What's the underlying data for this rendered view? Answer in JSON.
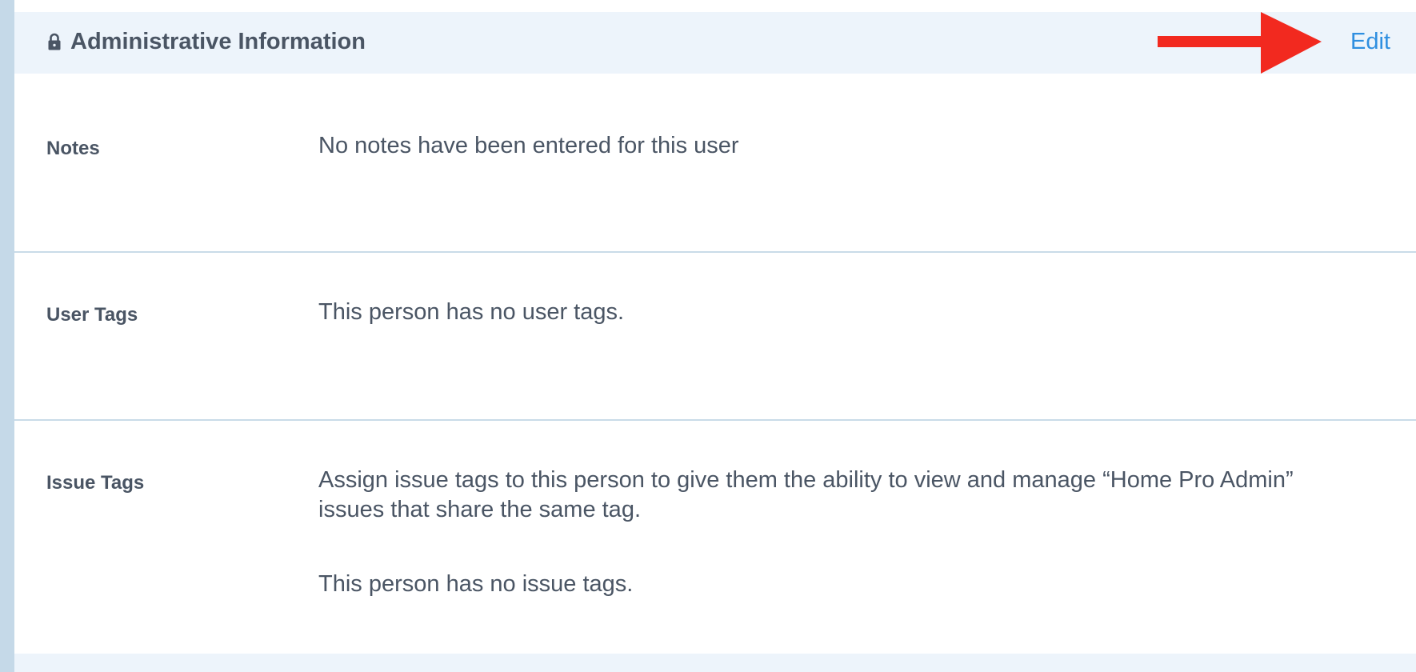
{
  "header": {
    "title": "Administrative Information",
    "edit_label": "Edit",
    "lock_icon": "lock-icon",
    "annotation_icon": "arrow-right-icon",
    "accent_color": "#2f8fe0",
    "annotation_color": "#f2291f"
  },
  "rows": {
    "notes": {
      "label": "Notes",
      "value": "No notes have been entered for this user"
    },
    "user_tags": {
      "label": "User Tags",
      "value": "This person has no user tags."
    },
    "issue_tags": {
      "label": "Issue Tags",
      "description": "Assign issue tags to this person to give them the ability to view and manage “Home Pro Admin” issues that share the same tag.",
      "value": "This person has no issue tags."
    }
  }
}
